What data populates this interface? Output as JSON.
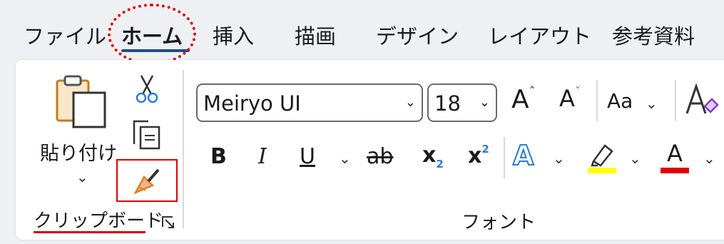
{
  "tabs": [
    {
      "label": "ファイル",
      "active": false
    },
    {
      "label": "ホーム",
      "active": true
    },
    {
      "label": "挿入",
      "active": false
    },
    {
      "label": "描画",
      "active": false
    },
    {
      "label": "デザイン",
      "active": false
    },
    {
      "label": "レイアウト",
      "active": false
    },
    {
      "label": "参考資料",
      "active": false
    }
  ],
  "clipboard": {
    "paste_label": "貼り付け",
    "group_label": "クリップボード"
  },
  "font": {
    "font_name": "Meiryo UI",
    "font_size": "18",
    "grow_label": "A",
    "shrink_label": "A",
    "case_label": "Aa",
    "bold_label": "B",
    "italic_label": "I",
    "underline_label": "U",
    "strike_label": "ab",
    "subscript_label": "x",
    "subscript_mark": "2",
    "superscript_label": "x",
    "superscript_mark": "2",
    "effects_label": "A",
    "font_color_label": "A",
    "group_label": "フォント"
  },
  "colors": {
    "highlight": "#ffff00",
    "font_color": "#e00000",
    "active_tab_underline": "#1f4e8c",
    "annotation_red": "#e00000"
  }
}
